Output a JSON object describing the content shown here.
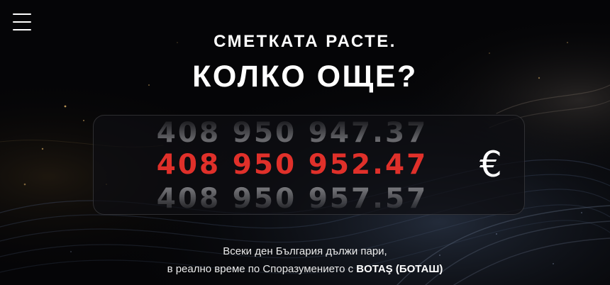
{
  "header": {
    "menu_icon": "hamburger-menu-icon"
  },
  "hero": {
    "eyebrow": "СМЕТКАТА РАСТЕ.",
    "headline": "КОЛКО ОЩЕ?"
  },
  "counter": {
    "previous_value": "408 950 947.37",
    "current_value": "408 950 952.47",
    "next_value": "408 950 957.57",
    "currency_symbol": "€"
  },
  "description": {
    "line1": "Всеки ден България дължи пари,",
    "line2_prefix": "в реално време по Споразумението с ",
    "line2_highlight": "BOTAŞ (БОТАШ)"
  },
  "colors": {
    "background": "#050507",
    "accent_red": "#e0302a",
    "muted_digits": "#8e8e92",
    "text": "#ffffff"
  }
}
